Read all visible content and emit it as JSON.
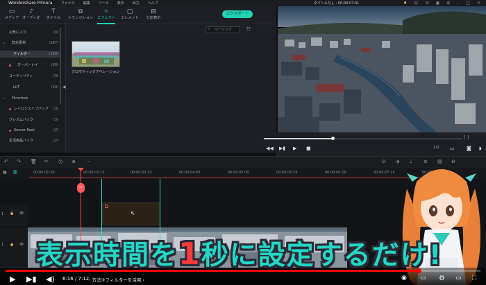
{
  "titlebar": {
    "app_name": "Wondershare Filmora",
    "menus": [
      "ファイル",
      "編集",
      "ツール",
      "表示",
      "出力",
      "ヘルプ"
    ],
    "document_title": "タイトルなし : 00:00:07:01"
  },
  "toolbar": {
    "tabs": [
      {
        "label": "メディア",
        "icon": "folder-icon"
      },
      {
        "label": "オーディオ",
        "icon": "music-icon"
      },
      {
        "label": "タイトル",
        "icon": "text-icon"
      },
      {
        "label": "トランジション",
        "icon": "transition-icon"
      },
      {
        "label": "エフェクト",
        "icon": "effects-icon",
        "active": true
      },
      {
        "label": "エレメント",
        "icon": "element-icon"
      },
      {
        "label": "分割表示",
        "icon": "split-screen-icon"
      }
    ],
    "export_label": "エクスポート"
  },
  "left_panel": {
    "items": [
      {
        "label": "お気に入り",
        "count": "(0)"
      },
      {
        "label": "既定素材",
        "count": "(287)"
      },
      {
        "label": "フィルター",
        "count": "(160)",
        "selected": true
      },
      {
        "label": "オーバーレイ",
        "count": "(93)"
      },
      {
        "label": "ユーティリティ",
        "count": "(9)"
      },
      {
        "label": "LUT",
        "count": "(20)"
      },
      {
        "label": "Filmstock",
        "count": ""
      },
      {
        "label": "レトロシェイプパック",
        "count": "(3)"
      },
      {
        "label": "クレズムパック",
        "count": "(3)"
      },
      {
        "label": "Soccer Pack",
        "count": "(2)"
      },
      {
        "label": "生活用品パック",
        "count": "(2)"
      }
    ]
  },
  "browser": {
    "search_placeholder": "ベーシック",
    "thumbnail_caption": "クロマティックアベレーション"
  },
  "preview": {
    "page_fraction": "1/2"
  },
  "ruler": {
    "ticks": [
      "00:00:01:20",
      "00:00:02:15",
      "00:00:03:10",
      "00:00:04:05",
      "00:00:05:00",
      "00:00:05:25",
      "00:00:06:20",
      "00:00:07:15",
      "00:00:08:10"
    ]
  },
  "timeline": {
    "track_labels": [
      "1",
      "1"
    ],
    "playhead_marker": "✂"
  },
  "caption": {
    "part1": "表示時間を",
    "highlight": "1",
    "part2": "秒に設定するだけ!"
  },
  "youtube": {
    "time": "6:16 / 7:12",
    "chapter": "・方法③フィルターを活用 ›",
    "progress_fraction": 0.87
  }
}
